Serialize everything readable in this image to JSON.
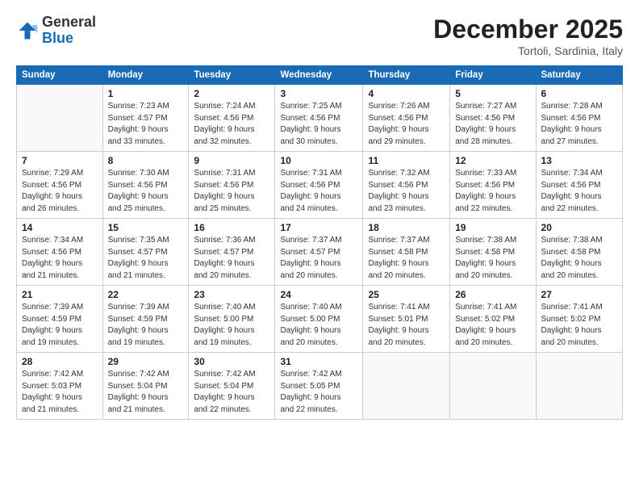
{
  "header": {
    "logo_general": "General",
    "logo_blue": "Blue",
    "month_title": "December 2025",
    "location": "Tortoli, Sardinia, Italy"
  },
  "days_of_week": [
    "Sunday",
    "Monday",
    "Tuesday",
    "Wednesday",
    "Thursday",
    "Friday",
    "Saturday"
  ],
  "weeks": [
    [
      {
        "day": "",
        "info": ""
      },
      {
        "day": "1",
        "info": "Sunrise: 7:23 AM\nSunset: 4:57 PM\nDaylight: 9 hours\nand 33 minutes."
      },
      {
        "day": "2",
        "info": "Sunrise: 7:24 AM\nSunset: 4:56 PM\nDaylight: 9 hours\nand 32 minutes."
      },
      {
        "day": "3",
        "info": "Sunrise: 7:25 AM\nSunset: 4:56 PM\nDaylight: 9 hours\nand 30 minutes."
      },
      {
        "day": "4",
        "info": "Sunrise: 7:26 AM\nSunset: 4:56 PM\nDaylight: 9 hours\nand 29 minutes."
      },
      {
        "day": "5",
        "info": "Sunrise: 7:27 AM\nSunset: 4:56 PM\nDaylight: 9 hours\nand 28 minutes."
      },
      {
        "day": "6",
        "info": "Sunrise: 7:28 AM\nSunset: 4:56 PM\nDaylight: 9 hours\nand 27 minutes."
      }
    ],
    [
      {
        "day": "7",
        "info": "Sunrise: 7:29 AM\nSunset: 4:56 PM\nDaylight: 9 hours\nand 26 minutes."
      },
      {
        "day": "8",
        "info": "Sunrise: 7:30 AM\nSunset: 4:56 PM\nDaylight: 9 hours\nand 25 minutes."
      },
      {
        "day": "9",
        "info": "Sunrise: 7:31 AM\nSunset: 4:56 PM\nDaylight: 9 hours\nand 25 minutes."
      },
      {
        "day": "10",
        "info": "Sunrise: 7:31 AM\nSunset: 4:56 PM\nDaylight: 9 hours\nand 24 minutes."
      },
      {
        "day": "11",
        "info": "Sunrise: 7:32 AM\nSunset: 4:56 PM\nDaylight: 9 hours\nand 23 minutes."
      },
      {
        "day": "12",
        "info": "Sunrise: 7:33 AM\nSunset: 4:56 PM\nDaylight: 9 hours\nand 22 minutes."
      },
      {
        "day": "13",
        "info": "Sunrise: 7:34 AM\nSunset: 4:56 PM\nDaylight: 9 hours\nand 22 minutes."
      }
    ],
    [
      {
        "day": "14",
        "info": "Sunrise: 7:34 AM\nSunset: 4:56 PM\nDaylight: 9 hours\nand 21 minutes."
      },
      {
        "day": "15",
        "info": "Sunrise: 7:35 AM\nSunset: 4:57 PM\nDaylight: 9 hours\nand 21 minutes."
      },
      {
        "day": "16",
        "info": "Sunrise: 7:36 AM\nSunset: 4:57 PM\nDaylight: 9 hours\nand 20 minutes."
      },
      {
        "day": "17",
        "info": "Sunrise: 7:37 AM\nSunset: 4:57 PM\nDaylight: 9 hours\nand 20 minutes."
      },
      {
        "day": "18",
        "info": "Sunrise: 7:37 AM\nSunset: 4:58 PM\nDaylight: 9 hours\nand 20 minutes."
      },
      {
        "day": "19",
        "info": "Sunrise: 7:38 AM\nSunset: 4:58 PM\nDaylight: 9 hours\nand 20 minutes."
      },
      {
        "day": "20",
        "info": "Sunrise: 7:38 AM\nSunset: 4:58 PM\nDaylight: 9 hours\nand 20 minutes."
      }
    ],
    [
      {
        "day": "21",
        "info": "Sunrise: 7:39 AM\nSunset: 4:59 PM\nDaylight: 9 hours\nand 19 minutes."
      },
      {
        "day": "22",
        "info": "Sunrise: 7:39 AM\nSunset: 4:59 PM\nDaylight: 9 hours\nand 19 minutes."
      },
      {
        "day": "23",
        "info": "Sunrise: 7:40 AM\nSunset: 5:00 PM\nDaylight: 9 hours\nand 19 minutes."
      },
      {
        "day": "24",
        "info": "Sunrise: 7:40 AM\nSunset: 5:00 PM\nDaylight: 9 hours\nand 20 minutes."
      },
      {
        "day": "25",
        "info": "Sunrise: 7:41 AM\nSunset: 5:01 PM\nDaylight: 9 hours\nand 20 minutes."
      },
      {
        "day": "26",
        "info": "Sunrise: 7:41 AM\nSunset: 5:02 PM\nDaylight: 9 hours\nand 20 minutes."
      },
      {
        "day": "27",
        "info": "Sunrise: 7:41 AM\nSunset: 5:02 PM\nDaylight: 9 hours\nand 20 minutes."
      }
    ],
    [
      {
        "day": "28",
        "info": "Sunrise: 7:42 AM\nSunset: 5:03 PM\nDaylight: 9 hours\nand 21 minutes."
      },
      {
        "day": "29",
        "info": "Sunrise: 7:42 AM\nSunset: 5:04 PM\nDaylight: 9 hours\nand 21 minutes."
      },
      {
        "day": "30",
        "info": "Sunrise: 7:42 AM\nSunset: 5:04 PM\nDaylight: 9 hours\nand 22 minutes."
      },
      {
        "day": "31",
        "info": "Sunrise: 7:42 AM\nSunset: 5:05 PM\nDaylight: 9 hours\nand 22 minutes."
      },
      {
        "day": "",
        "info": ""
      },
      {
        "day": "",
        "info": ""
      },
      {
        "day": "",
        "info": ""
      }
    ]
  ]
}
